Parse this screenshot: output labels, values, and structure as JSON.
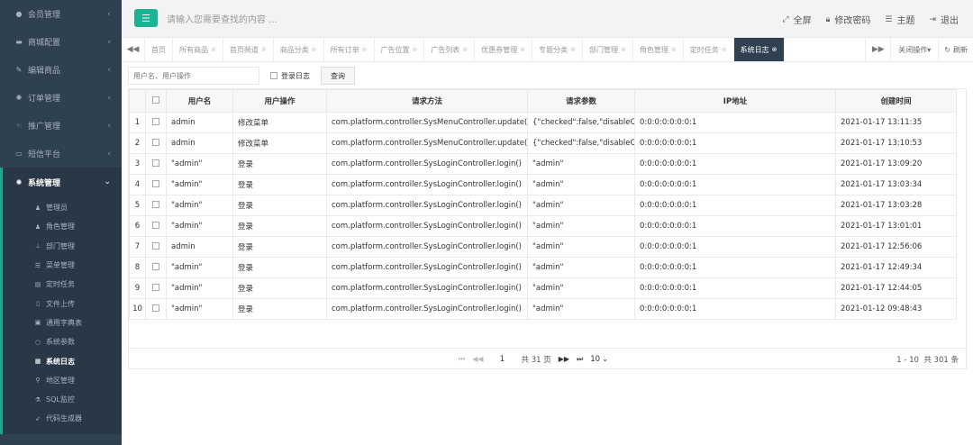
{
  "sidebar": {
    "menus": [
      {
        "label": "会员管理",
        "icon": "user-circle-icon"
      },
      {
        "label": "商城配置",
        "icon": "cart-icon"
      },
      {
        "label": "编辑商品",
        "icon": "edit-icon"
      },
      {
        "label": "订单管理",
        "icon": "gear-icon"
      },
      {
        "label": "推广管理",
        "icon": "hand-icon"
      },
      {
        "label": "短信平台",
        "icon": "monitor-icon"
      }
    ],
    "active_menu": {
      "label": "系统管理",
      "icon": "gear-icon"
    },
    "sub_items": [
      {
        "label": "管理员",
        "icon": "user-icon"
      },
      {
        "label": "角色管理",
        "icon": "users-icon"
      },
      {
        "label": "部门管理",
        "icon": "sitemap-icon"
      },
      {
        "label": "菜单管理",
        "icon": "list-icon"
      },
      {
        "label": "定时任务",
        "icon": "tasks-icon"
      },
      {
        "label": "文件上传",
        "icon": "file-icon"
      },
      {
        "label": "通用字典表",
        "icon": "book-icon"
      },
      {
        "label": "系统参数",
        "icon": "circle-icon"
      },
      {
        "label": "系统日志",
        "icon": "log-icon"
      },
      {
        "label": "地区管理",
        "icon": "map-pin-icon"
      },
      {
        "label": "SQL监控",
        "icon": "flask-icon"
      },
      {
        "label": "代码生成器",
        "icon": "rocket-icon"
      }
    ]
  },
  "header": {
    "search_placeholder": "请输入您需要查找的内容 ...",
    "actions": [
      {
        "label": "全屏",
        "icon": "expand-icon"
      },
      {
        "label": "修改密码",
        "icon": "lock-icon"
      },
      {
        "label": "主题",
        "icon": "menu-icon"
      },
      {
        "label": "退出",
        "icon": "signout-icon"
      }
    ]
  },
  "tabs": {
    "items": [
      "首页",
      "所有商品",
      "首页频道",
      "商品分类",
      "所有订单",
      "广告位置",
      "广告列表",
      "优惠券管理",
      "专题分类",
      "部门管理",
      "角色管理",
      "定时任务",
      "系统日志"
    ],
    "active": "系统日志",
    "close_ops_label": "关闭操作",
    "refresh_label": "刷新"
  },
  "filter": {
    "input_placeholder": "用户名、用户操作",
    "checkbox_label": "登录日志",
    "query_label": "查询"
  },
  "table": {
    "columns": [
      "用户名",
      "用户操作",
      "请求方法",
      "请求参数",
      "IP地址",
      "创建时间"
    ],
    "rows": [
      {
        "num": "1",
        "user": "admin",
        "op": "修改菜单",
        "method": "com.platform.controller.SysMenuController.update()",
        "params": "{\"checked\":false,\"disableChe",
        "ip": "0:0:0:0:0:0:0:1",
        "time": "2021-01-17 13:11:35"
      },
      {
        "num": "2",
        "user": "admin",
        "op": "修改菜单",
        "method": "com.platform.controller.SysMenuController.update()",
        "params": "{\"checked\":false,\"disableChe",
        "ip": "0:0:0:0:0:0:0:1",
        "time": "2021-01-17 13:10:53"
      },
      {
        "num": "3",
        "user": "\"admin\"",
        "op": "登录",
        "method": "com.platform.controller.SysLoginController.login()",
        "params": "\"admin\"",
        "ip": "0:0:0:0:0:0:0:1",
        "time": "2021-01-17 13:09:20"
      },
      {
        "num": "4",
        "user": "\"admin\"",
        "op": "登录",
        "method": "com.platform.controller.SysLoginController.login()",
        "params": "\"admin\"",
        "ip": "0:0:0:0:0:0:0:1",
        "time": "2021-01-17 13:03:34"
      },
      {
        "num": "5",
        "user": "\"admin\"",
        "op": "登录",
        "method": "com.platform.controller.SysLoginController.login()",
        "params": "\"admin\"",
        "ip": "0:0:0:0:0:0:0:1",
        "time": "2021-01-17 13:03:28"
      },
      {
        "num": "6",
        "user": "\"admin\"",
        "op": "登录",
        "method": "com.platform.controller.SysLoginController.login()",
        "params": "\"admin\"",
        "ip": "0:0:0:0:0:0:0:1",
        "time": "2021-01-17 13:01:01"
      },
      {
        "num": "7",
        "user": "admin",
        "op": "登录",
        "method": "com.platform.controller.SysLoginController.login()",
        "params": "\"admin\"",
        "ip": "0:0:0:0:0:0:0:1",
        "time": "2021-01-17 12:56:06"
      },
      {
        "num": "8",
        "user": "\"admin\"",
        "op": "登录",
        "method": "com.platform.controller.SysLoginController.login()",
        "params": "\"admin\"",
        "ip": "0:0:0:0:0:0:0:1",
        "time": "2021-01-17 12:49:34"
      },
      {
        "num": "9",
        "user": "\"admin\"",
        "op": "登录",
        "method": "com.platform.controller.SysLoginController.login()",
        "params": "\"admin\"",
        "ip": "0:0:0:0:0:0:0:1",
        "time": "2021-01-17 12:44:05"
      },
      {
        "num": "10",
        "user": "\"admin\"",
        "op": "登录",
        "method": "com.platform.controller.SysLoginController.login()",
        "params": "\"admin\"",
        "ip": "0:0:0:0:0:0:0:1",
        "time": "2021-01-12 09:48:43"
      }
    ]
  },
  "pager": {
    "current_page": "1",
    "total_pages_text": "共 31 页",
    "page_size": "10",
    "range_text": "1 - 10",
    "total_text": "共 301 条"
  },
  "colors": {
    "sidebar_bg": "#2f4050",
    "accent": "#1ab394",
    "active_tab": "#2f4050"
  }
}
